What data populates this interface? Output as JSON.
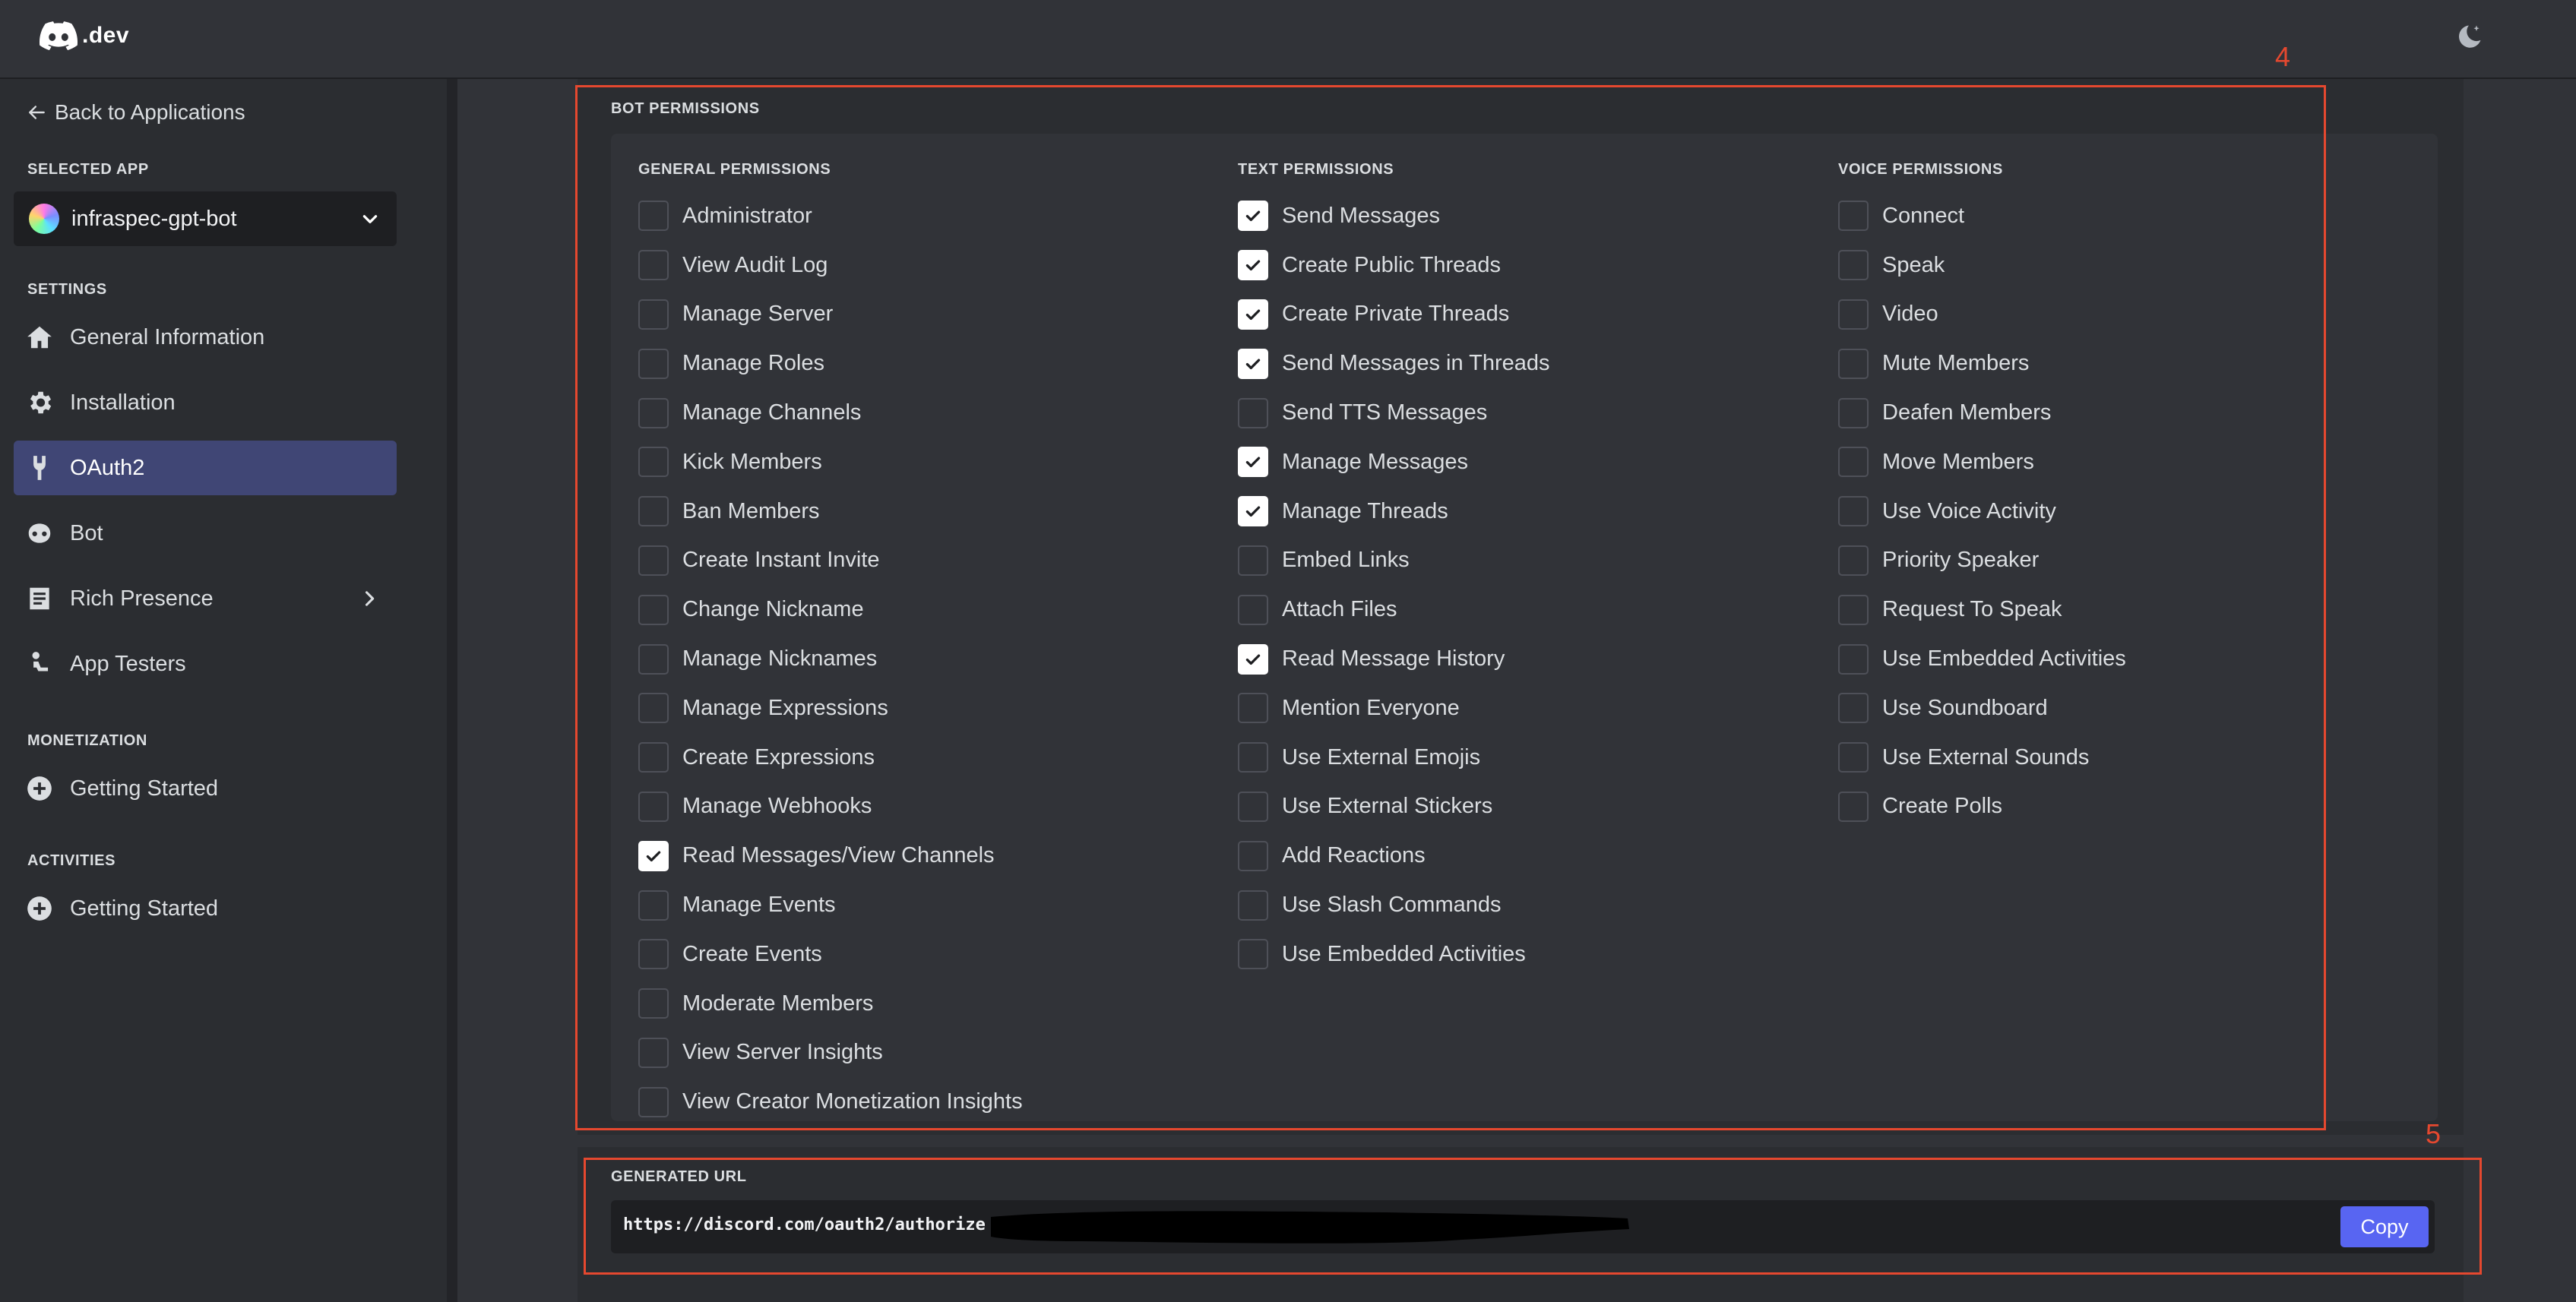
{
  "brand": {
    "suffix": ".dev"
  },
  "sidebar": {
    "back_label": "Back to Applications",
    "selected_app_label": "SELECTED APP",
    "app_name": "infraspec-gpt-bot",
    "settings_label": "SETTINGS",
    "settings_items": [
      {
        "label": "General Information",
        "icon": "home-icon"
      },
      {
        "label": "Installation",
        "icon": "gear-icon"
      },
      {
        "label": "OAuth2",
        "icon": "wrench-icon",
        "active": true
      },
      {
        "label": "Bot",
        "icon": "bot-icon"
      },
      {
        "label": "Rich Presence",
        "icon": "document-icon"
      },
      {
        "label": "App Testers",
        "icon": "person-icon"
      }
    ],
    "monetization_label": "MONETIZATION",
    "monetization_items": [
      {
        "label": "Getting Started",
        "icon": "plus-circle-icon"
      }
    ],
    "activities_label": "ACTIVITIES",
    "activities_items": [
      {
        "label": "Getting Started",
        "icon": "plus-circle-icon"
      }
    ]
  },
  "bot_permissions": {
    "title": "BOT PERMISSIONS",
    "annotation": "4",
    "general": {
      "title": "GENERAL PERMISSIONS",
      "items": [
        {
          "label": "Administrator",
          "checked": false
        },
        {
          "label": "View Audit Log",
          "checked": false
        },
        {
          "label": "Manage Server",
          "checked": false
        },
        {
          "label": "Manage Roles",
          "checked": false
        },
        {
          "label": "Manage Channels",
          "checked": false
        },
        {
          "label": "Kick Members",
          "checked": false
        },
        {
          "label": "Ban Members",
          "checked": false
        },
        {
          "label": "Create Instant Invite",
          "checked": false
        },
        {
          "label": "Change Nickname",
          "checked": false
        },
        {
          "label": "Manage Nicknames",
          "checked": false
        },
        {
          "label": "Manage Expressions",
          "checked": false
        },
        {
          "label": "Create Expressions",
          "checked": false
        },
        {
          "label": "Manage Webhooks",
          "checked": false
        },
        {
          "label": "Read Messages/View Channels",
          "checked": true
        },
        {
          "label": "Manage Events",
          "checked": false
        },
        {
          "label": "Create Events",
          "checked": false
        },
        {
          "label": "Moderate Members",
          "checked": false
        },
        {
          "label": "View Server Insights",
          "checked": false
        },
        {
          "label": "View Creator Monetization Insights",
          "checked": false
        }
      ]
    },
    "text": {
      "title": "TEXT PERMISSIONS",
      "items": [
        {
          "label": "Send Messages",
          "checked": true
        },
        {
          "label": "Create Public Threads",
          "checked": true
        },
        {
          "label": "Create Private Threads",
          "checked": true
        },
        {
          "label": "Send Messages in Threads",
          "checked": true
        },
        {
          "label": "Send TTS Messages",
          "checked": false
        },
        {
          "label": "Manage Messages",
          "checked": true
        },
        {
          "label": "Manage Threads",
          "checked": true
        },
        {
          "label": "Embed Links",
          "checked": false
        },
        {
          "label": "Attach Files",
          "checked": false
        },
        {
          "label": "Read Message History",
          "checked": true
        },
        {
          "label": "Mention Everyone",
          "checked": false
        },
        {
          "label": "Use External Emojis",
          "checked": false
        },
        {
          "label": "Use External Stickers",
          "checked": false
        },
        {
          "label": "Add Reactions",
          "checked": false
        },
        {
          "label": "Use Slash Commands",
          "checked": false
        },
        {
          "label": "Use Embedded Activities",
          "checked": false
        }
      ]
    },
    "voice": {
      "title": "VOICE PERMISSIONS",
      "items": [
        {
          "label": "Connect",
          "checked": false
        },
        {
          "label": "Speak",
          "checked": false
        },
        {
          "label": "Video",
          "checked": false
        },
        {
          "label": "Mute Members",
          "checked": false
        },
        {
          "label": "Deafen Members",
          "checked": false
        },
        {
          "label": "Move Members",
          "checked": false
        },
        {
          "label": "Use Voice Activity",
          "checked": false
        },
        {
          "label": "Priority Speaker",
          "checked": false
        },
        {
          "label": "Request To Speak",
          "checked": false
        },
        {
          "label": "Use Embedded Activities",
          "checked": false
        },
        {
          "label": "Use Soundboard",
          "checked": false
        },
        {
          "label": "Use External Sounds",
          "checked": false
        },
        {
          "label": "Create Polls",
          "checked": false
        }
      ]
    }
  },
  "generated_url": {
    "title": "GENERATED URL",
    "annotation": "5",
    "value": "https://discord.com/oauth2/authorize",
    "copy_label": "Copy"
  },
  "colors": {
    "accent": "#5865f2",
    "annotation": "#e5482f",
    "active_nav": "#404675"
  }
}
